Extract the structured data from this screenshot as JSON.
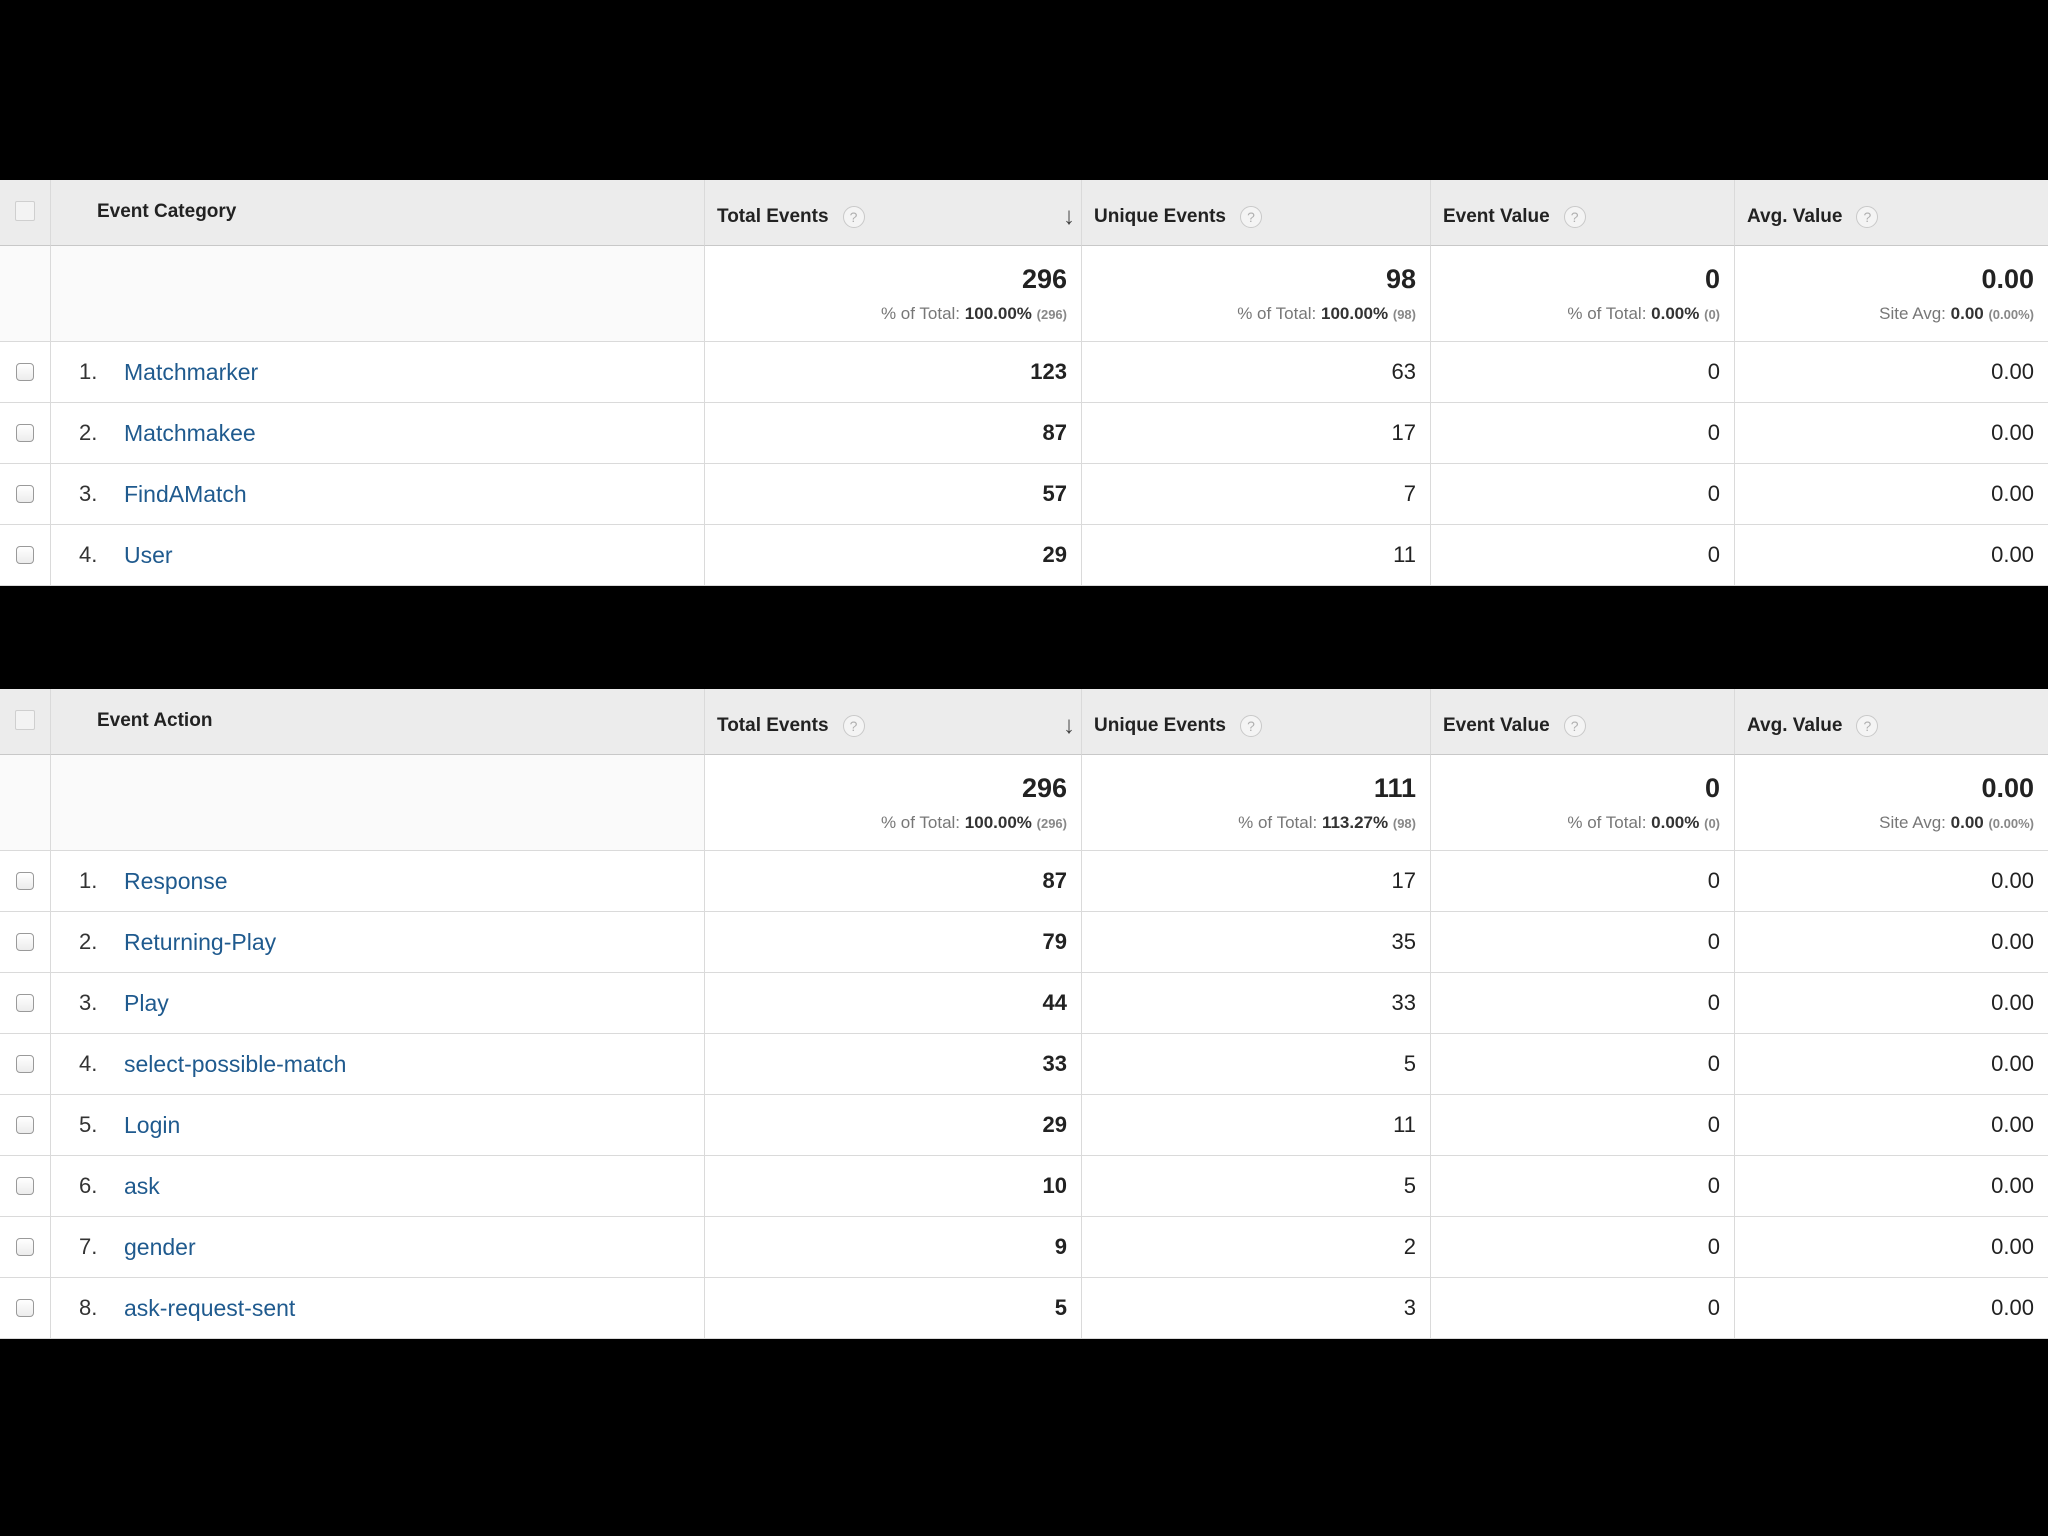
{
  "columns": {
    "total_events": "Total Events",
    "unique_events": "Unique Events",
    "event_value": "Event Value",
    "avg_value": "Avg. Value",
    "help_glyph": "?",
    "sort_glyph": "↓"
  },
  "reports": [
    {
      "dimension": "Event Category",
      "totals": {
        "total_events": {
          "value": "296",
          "label": "% of Total:",
          "pct": "100.00%",
          "base": "(296)"
        },
        "unique_events": {
          "value": "98",
          "label": "% of Total:",
          "pct": "100.00%",
          "base": "(98)"
        },
        "event_value": {
          "value": "0",
          "label": "% of Total:",
          "pct": "0.00%",
          "base": "(0)"
        },
        "avg_value": {
          "value": "0.00",
          "label": "Site Avg:",
          "pct": "0.00",
          "base": "(0.00%)"
        }
      },
      "rows": [
        {
          "num": "1.",
          "name": "Matchmarker",
          "total_events": "123",
          "unique_events": "63",
          "event_value": "0",
          "avg_value": "0.00"
        },
        {
          "num": "2.",
          "name": "Matchmakee",
          "total_events": "87",
          "unique_events": "17",
          "event_value": "0",
          "avg_value": "0.00"
        },
        {
          "num": "3.",
          "name": "FindAMatch",
          "total_events": "57",
          "unique_events": "7",
          "event_value": "0",
          "avg_value": "0.00"
        },
        {
          "num": "4.",
          "name": "User",
          "total_events": "29",
          "unique_events": "11",
          "event_value": "0",
          "avg_value": "0.00"
        }
      ]
    },
    {
      "dimension": "Event Action",
      "totals": {
        "total_events": {
          "value": "296",
          "label": "% of Total:",
          "pct": "100.00%",
          "base": "(296)"
        },
        "unique_events": {
          "value": "111",
          "label": "% of Total:",
          "pct": "113.27%",
          "base": "(98)"
        },
        "event_value": {
          "value": "0",
          "label": "% of Total:",
          "pct": "0.00%",
          "base": "(0)"
        },
        "avg_value": {
          "value": "0.00",
          "label": "Site Avg:",
          "pct": "0.00",
          "base": "(0.00%)"
        }
      },
      "rows": [
        {
          "num": "1.",
          "name": "Response",
          "total_events": "87",
          "unique_events": "17",
          "event_value": "0",
          "avg_value": "0.00"
        },
        {
          "num": "2.",
          "name": "Returning-Play",
          "total_events": "79",
          "unique_events": "35",
          "event_value": "0",
          "avg_value": "0.00"
        },
        {
          "num": "3.",
          "name": "Play",
          "total_events": "44",
          "unique_events": "33",
          "event_value": "0",
          "avg_value": "0.00"
        },
        {
          "num": "4.",
          "name": "select-possible-match",
          "total_events": "33",
          "unique_events": "5",
          "event_value": "0",
          "avg_value": "0.00"
        },
        {
          "num": "5.",
          "name": "Login",
          "total_events": "29",
          "unique_events": "11",
          "event_value": "0",
          "avg_value": "0.00"
        },
        {
          "num": "6.",
          "name": "ask",
          "total_events": "10",
          "unique_events": "5",
          "event_value": "0",
          "avg_value": "0.00"
        },
        {
          "num": "7.",
          "name": "gender",
          "total_events": "9",
          "unique_events": "2",
          "event_value": "0",
          "avg_value": "0.00"
        },
        {
          "num": "8.",
          "name": "ask-request-sent",
          "total_events": "5",
          "unique_events": "3",
          "event_value": "0",
          "avg_value": "0.00"
        }
      ]
    }
  ]
}
